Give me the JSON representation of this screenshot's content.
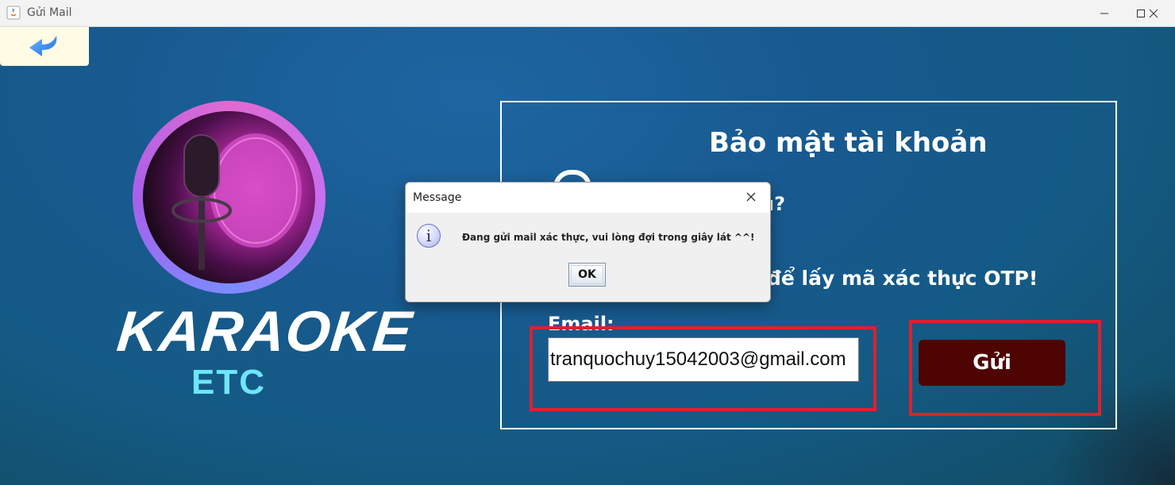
{
  "window": {
    "title": "Gửi Mail",
    "controls": [
      "minimize",
      "maximize",
      "close"
    ]
  },
  "back_button": {
    "icon": "undo-arrow-icon"
  },
  "logo": {
    "line1": "KARAOKE",
    "line2": "ETC",
    "image": "microphone-logo"
  },
  "panel": {
    "title": "Bảo mật tài khoản",
    "question_partial": "u?",
    "instruction_partial": "để lấy mã xác thực OTP!",
    "email_label": "Email:",
    "email_value": "tranquochuy15042003@gmail.com",
    "send_label": "Gửi"
  },
  "dialog": {
    "title": "Message",
    "message": "Đang gửi mail xác thực, vui lòng đợi trong giây lát ^^!",
    "ok_label": "OK",
    "icon": "info-icon"
  },
  "colors": {
    "highlight_red": "#e0202a",
    "send_button": "#4e0401",
    "back_button_bg": "#fffbe5",
    "logo_sub": "#6fe6ff"
  }
}
